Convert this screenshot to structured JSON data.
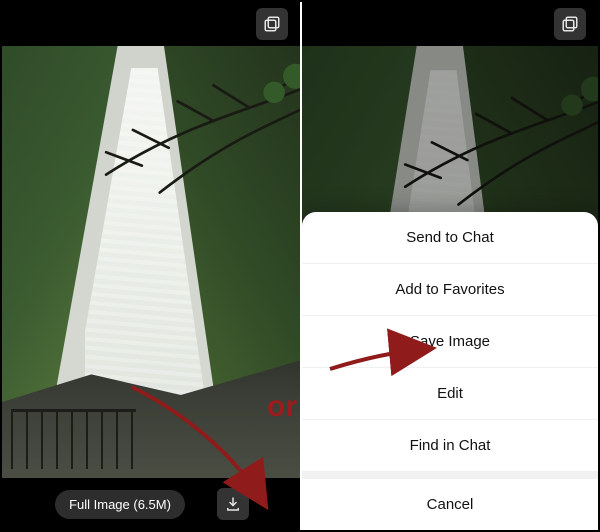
{
  "left": {
    "full_image_label": "Full Image (6.5M)"
  },
  "sheet": {
    "items": [
      "Send to Chat",
      "Add to Favorites",
      "Save Image",
      "Edit",
      "Find in Chat"
    ],
    "cancel": "Cancel"
  },
  "annotation": {
    "or": "or"
  }
}
